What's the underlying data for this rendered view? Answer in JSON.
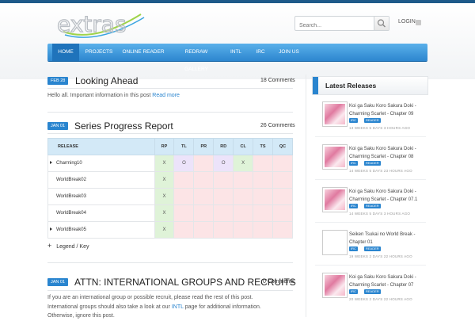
{
  "header": {
    "search_placeholder": "Search...",
    "login_label": "LOGIN"
  },
  "nav": {
    "items": [
      "HOME",
      "PROJECTS",
      "ONLINE READER",
      "REDRAW GALLERY",
      "INTL",
      "IRC",
      "JOIN US"
    ],
    "active": "HOME"
  },
  "posts": [
    {
      "date": "FEB 28",
      "title": "Looking Ahead",
      "comments": "18 Comments",
      "text": "Hello all. Important information in this post",
      "read_more": "Read more"
    },
    {
      "date": "JAN 01",
      "title": "Series Progress Report",
      "comments": "26 Comments"
    },
    {
      "date": "JAN 01",
      "title": "ATTN: INTERNATIONAL GROUPS AND RECRUITS",
      "comments": "0 Comments",
      "text_1": "If you are an international group or possible recruit, please read the rest of this post.",
      "text_2a": "International groups should also take a look at our",
      "text_2_link": "INTL",
      "text_2b": "page for additional information.",
      "text_3": "Otherwise, ignore this post."
    }
  ],
  "progress_table": {
    "headers": [
      "RELEASE",
      "RP",
      "TL",
      "PR",
      "RD",
      "CL",
      "TS",
      "QC"
    ],
    "rows": [
      {
        "name": "Charming10",
        "cells": [
          "X",
          "O",
          "",
          "O",
          "X",
          "",
          ""
        ]
      },
      {
        "name": "WorldBreak02",
        "cells": [
          "X",
          "",
          "",
          "",
          "",
          "",
          ""
        ]
      },
      {
        "name": "WorldBreak03",
        "cells": [
          "X",
          "",
          "",
          "",
          "",
          "",
          ""
        ]
      },
      {
        "name": "WorldBreak04",
        "cells": [
          "X",
          "",
          "",
          "",
          "",
          "",
          ""
        ]
      },
      {
        "name": "WorldBreak05",
        "cells": [
          "X",
          "",
          "",
          "",
          "",
          "",
          ""
        ]
      }
    ],
    "legend_label": "Legend / Key"
  },
  "sidebar": {
    "title": "Latest Releases",
    "releases": [
      {
        "title": "Koi ga Saku Koro Sakura Doki - Charming Scarlet - Chapter 09",
        "tags": [
          "IRC",
          "READER"
        ],
        "time": "13 WEEKS 5 DAYS 3 HOURS AGO"
      },
      {
        "title": "Koi ga Saku Koro Sakura Doki - Charming Scarlet - Chapter 08",
        "tags": [
          "IRC",
          "READER"
        ],
        "time": "14 WEEKS 5 DAYS 23 HOURS AGO"
      },
      {
        "title": "Koi ga Saku Koro Sakura Doki - Charming Scarlet - Chapter 07.1",
        "tags": [
          "IRC",
          "READER"
        ],
        "time": "14 WEEKS 5 DAYS 3 HOURS AGO"
      },
      {
        "title": "Seiken Tsukai no World Break - Chapter 01",
        "tags": [
          "IRC",
          "READER"
        ],
        "time": "19 WEEKS 2 DAYS 22 HOURS AGO"
      },
      {
        "title": "Koi ga Saku Koro Sakura Doki - Charming Scarlet - Chapter 07",
        "tags": [
          "IRC",
          "READER"
        ],
        "time": "20 WEEKS 2 DAYS 22 HOURS AGO"
      }
    ]
  },
  "colors": {
    "accent": "#2a85cf",
    "nav_top": "#5ab0ea",
    "nav_bottom": "#2d86cf",
    "cell_done": "#dff3d8",
    "cell_in_progress": "#ece3fa",
    "cell_todo": "#fce4e6"
  }
}
